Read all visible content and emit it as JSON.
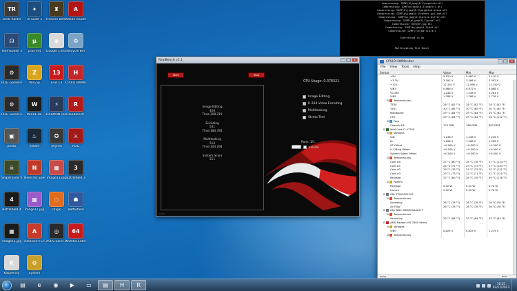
{
  "desktop_icons": [
    {
      "label": "Tomb Raider",
      "color": "#3b3b3b",
      "glyph": "TR"
    },
    {
      "label": "AI Suite 3",
      "color": "#1c4e7f",
      "glyph": "✦"
    },
    {
      "label": "Heaven Benchma...",
      "color": "#4a3a1e",
      "glyph": "♜"
    },
    {
      "label": "Adobe Reader X",
      "color": "#b31414",
      "glyph": "A"
    },
    {
      "label": "TeamSpeak 3 Client",
      "color": "#2a4a7a",
      "glyph": "☊"
    },
    {
      "label": "µTorrent",
      "color": "#3a8a2a",
      "glyph": "µ"
    },
    {
      "label": "Google Chrome",
      "color": "#d8d8d8",
      "glyph": "◉"
    },
    {
      "label": "Recycle Bin",
      "color": "#7aa3c8",
      "glyph": "♻"
    },
    {
      "label": "ROG GameFirst II",
      "color": "#2a2a2a",
      "glyph": "⚙"
    },
    {
      "label": "WinZip",
      "color": "#d8a41c",
      "glyph": "Z"
    },
    {
      "label": "FIFA 13",
      "color": "#c81c1c",
      "glyph": "13"
    },
    {
      "label": "CPUID HWMonitor",
      "color": "#c0282b",
      "glyph": "H"
    },
    {
      "label": "ROG GameFirst...",
      "color": "#2a2a2a",
      "glyph": "⚙"
    },
    {
      "label": "WinRE.RE",
      "color": "#1c1c1c",
      "glyph": "W"
    },
    {
      "label": "DAEMON Tools Lite",
      "color": "#2a3a5a",
      "glyph": "⚡"
    },
    {
      "label": "RealBench",
      "color": "#b31b1b",
      "glyph": "R"
    },
    {
      "label": "photo",
      "color": "#555",
      "glyph": "▣"
    },
    {
      "label": "Steam",
      "color": "#1b2838",
      "glyph": "♨"
    },
    {
      "label": "Skyrim",
      "color": "#3a3a3a",
      "glyph": "✪"
    },
    {
      "label": "ROG",
      "color": "#a31a1a",
      "glyph": "⚔"
    },
    {
      "label": "Sniper Elite V2",
      "color": "#3a4a2a",
      "glyph": "☠"
    },
    {
      "label": "Need for Speed",
      "color": "#c0392b",
      "glyph": "N"
    },
    {
      "label": "image13.jpg",
      "color": "#c84a4a",
      "glyph": "▦"
    },
    {
      "label": "Battlefield 3",
      "color": "#2a2a2a",
      "glyph": "3"
    },
    {
      "label": "Battlefield 4",
      "color": "#1a1a1a",
      "glyph": "4"
    },
    {
      "label": "image12.jpg",
      "color": "#9a5ac8",
      "glyph": "▦"
    },
    {
      "label": "Origin",
      "color": "#e06c1c",
      "glyph": "◌"
    },
    {
      "label": "Battlefield",
      "color": "#2f5aa0",
      "glyph": "☗"
    },
    {
      "label": "image11.jpg",
      "color": "#1a1a1a",
      "glyph": "▦"
    },
    {
      "label": "Assassin's Creed",
      "color": "#c83a2a",
      "glyph": "A"
    },
    {
      "label": "ASUS Sonic Radar",
      "color": "#2a2a2a",
      "glyph": "◎"
    },
    {
      "label": "AIDA64 Extreme",
      "color": "#c81c1c",
      "glyph": "64"
    },
    {
      "label": "Kaspersky",
      "color": "#d8d8d8",
      "glyph": "K"
    },
    {
      "label": "System",
      "color": "#c8a02a",
      "glyph": "⚙"
    }
  ],
  "console": {
    "lines": [
      "Compressing: G2MF\\b\\jpeg\\0.2\\pngstate.dll",
      "Compressing: G2MF\\b\\jpeg\\0.3\\pngctrl.dll",
      "Compressing: G2MF\\b\\jpeg\\0.3\\weighted.blend.dll",
      "Compressing: G2MF\\b\\jpeg\\0.3\\render.ppl_cad.dll",
      "Compressing: G2MF\\b\\jpeg\\0.3\\write.buffer.dll",
      "Compressing: G2MF\\b\\jpeg\\0.2\\pixel.dll",
      "Compressing: Render\\jpg.dll",
      "Compressing: G2MF\\b\\jpeg\\0.2\\mft.dll",
      "Compressing: G2MF\\c\\e\\bd\\lib.dll",
      "",
      "Everything is Ok",
      "",
      "",
      "Multitasking Test Done!"
    ]
  },
  "realbench": {
    "title": "RealBench v1.1",
    "buttons": {
      "start": "Start",
      "stop": "Stop"
    },
    "results": [
      {
        "name": "Image Editing",
        "score": "400",
        "time": "Time:208.219"
      },
      {
        "name": "Encoding",
        "score": "541",
        "time": "Time:184.783"
      },
      {
        "name": "Multitasking",
        "score": "514",
        "time": "Time:104.294"
      }
    ],
    "system_score_label": "System Score",
    "system_score": "511",
    "cpu_usage": "CPU Usage: 0.378321",
    "options": [
      {
        "label": "Image Editing",
        "checked": true
      },
      {
        "label": "H.264 Video Encoding",
        "checked": true
      },
      {
        "label": "Multitasking",
        "checked": true
      },
      {
        "label": "Stress Test",
        "checked": false
      }
    ],
    "runs_label": "Runs: 1/1",
    "infinite_label": "Infinite",
    "footer": "ASUS"
  },
  "hwmonitor": {
    "title": "CPUID HWMonitor",
    "menu": [
      "File",
      "View",
      "Tools",
      "Help"
    ],
    "columns": [
      "Sensor",
      "Value",
      "Min",
      "Max"
    ],
    "rows": [
      {
        "indent": 3,
        "name": "+5V",
        "value": "5.120 V",
        "min": "5.080 V",
        "max": "5.120 V"
      },
      {
        "indent": 3,
        "name": "+3.3V",
        "value": "3.392 V",
        "min": "3.368 V",
        "max": "3.392 V"
      },
      {
        "indent": 3,
        "name": "+12V",
        "value": "12.192 V",
        "min": "12.096 V",
        "max": "12.192 V"
      },
      {
        "indent": 3,
        "name": "VIN3",
        "value": "0.888 V",
        "min": "0.872 V",
        "max": "0.888 V"
      },
      {
        "indent": 3,
        "name": "VCORE",
        "value": "1.248 V",
        "min": "1.248 V",
        "max": "1.264 V"
      },
      {
        "indent": 3,
        "name": "VIN5",
        "value": "1.768 V",
        "min": "1.768 V",
        "max": "1.776 V"
      },
      {
        "indent": 2,
        "name": "Temperatures",
        "value": "",
        "min": "",
        "max": "",
        "group": "temp"
      },
      {
        "indent": 3,
        "name": "TZ00",
        "value": "28 °C (82 °F)",
        "min": "28 °C (82 °F)",
        "max": "28 °C (82 °F)"
      },
      {
        "indent": 3,
        "name": "TZ01",
        "value": "30 °C (85 °F)",
        "min": "30 °C (85 °F)",
        "max": "30 °C (85 °F)"
      },
      {
        "indent": 3,
        "name": "Mainboard",
        "value": "29 °C (84 °F)",
        "min": "29 °C (84 °F)",
        "max": "29 °C (84 °F)"
      },
      {
        "indent": 3,
        "name": "CPU",
        "value": "29 °C (84 °F)",
        "min": "29 °C (84 °F)",
        "max": "56 °C (132 °F)"
      },
      {
        "indent": 2,
        "name": "Fans",
        "value": "",
        "min": "",
        "max": "",
        "group": "fan"
      },
      {
        "indent": 3,
        "name": "Chassis #3",
        "value": "775 RPM",
        "min": "766 RPM",
        "max": "887 RPM"
      },
      {
        "indent": 1,
        "name": "Intel Core i7 4770K",
        "value": "",
        "min": "",
        "max": "",
        "group": "chip"
      },
      {
        "indent": 2,
        "name": "Voltages",
        "value": "",
        "min": "",
        "max": "",
        "group": "volt"
      },
      {
        "indent": 3,
        "name": "VID",
        "value": "1.238 V",
        "min": "1.238 V",
        "max": "1.238 V"
      },
      {
        "indent": 3,
        "name": "IA",
        "value": "1.268 V",
        "min": "1.268 V",
        "max": "1.268 V"
      },
      {
        "indent": 3,
        "name": "GT Offset",
        "value": "+0.000 V",
        "min": "+0.000 V",
        "max": "+0.000 V"
      },
      {
        "indent": 3,
        "name": "LLC/Ring Offset",
        "value": "+0.000 V",
        "min": "+0.000 V",
        "max": "+0.000 V"
      },
      {
        "indent": 3,
        "name": "System Agent Offset",
        "value": "+0.000 V",
        "min": "+0.000 V",
        "max": "+0.000 V"
      },
      {
        "indent": 2,
        "name": "Temperatures",
        "value": "",
        "min": "",
        "max": "",
        "group": "temp"
      },
      {
        "indent": 3,
        "name": "Core #0",
        "value": "27 °C (80 °F)",
        "min": "26 °C (78 °F)",
        "max": "57 °C (134 °F)"
      },
      {
        "indent": 3,
        "name": "Core #1",
        "value": "24 °C (75 °F)",
        "min": "23 °C (73 °F)",
        "max": "57 °C (134 °F)"
      },
      {
        "indent": 3,
        "name": "Core #2",
        "value": "26 °C (78 °F)",
        "min": "24 °C (75 °F)",
        "max": "55 °C (131 °F)"
      },
      {
        "indent": 3,
        "name": "Core #3",
        "value": "23 °C (73 °F)",
        "min": "22 °C (71 °F)",
        "max": "52 °C (125 °F)"
      },
      {
        "indent": 3,
        "name": "Package",
        "value": "27 °C (80 °F)",
        "min": "26 °C (78 °F)",
        "max": "59 °C (138 °F)"
      },
      {
        "indent": 2,
        "name": "Powers",
        "value": "",
        "min": "",
        "max": "",
        "group": "power"
      },
      {
        "indent": 3,
        "name": "Package",
        "value": "0.52 W",
        "min": "0.52 W",
        "max": "0.76 W"
      },
      {
        "indent": 3,
        "name": "Uncore",
        "value": "2.52 W",
        "min": "2.52 W",
        "max": "2.76 W"
      },
      {
        "indent": 1,
        "name": "ATA ST3500312CS",
        "value": "",
        "min": "",
        "max": "",
        "group": "disk"
      },
      {
        "indent": 2,
        "name": "Temperatures",
        "value": "",
        "min": "",
        "max": "",
        "group": "temp"
      },
      {
        "indent": 3,
        "name": "Assembly",
        "value": "26 °C (78 °F)",
        "min": "26 °C (78 °F)",
        "max": "26 °C (78 °F)"
      },
      {
        "indent": 3,
        "name": "Air Flow",
        "value": "26 °C (78 °F)",
        "min": "26 °C (78 °F)",
        "max": "26 °C (78 °F)"
      },
      {
        "indent": 1,
        "name": "ATA WDC WD5000AAKX-7",
        "value": "",
        "min": "",
        "max": "",
        "group": "disk"
      },
      {
        "indent": 2,
        "name": "Temperatures",
        "value": "",
        "min": "",
        "max": "",
        "group": "temp"
      },
      {
        "indent": 3,
        "name": "Assembly",
        "value": "29 °C (84 °F)",
        "min": "29 °C (84 °F)",
        "max": "29 °C (84 °F)"
      },
      {
        "indent": 1,
        "name": "AMD Radeon HD 7800 Series",
        "value": "",
        "min": "",
        "max": "",
        "group": "gpu"
      },
      {
        "indent": 2,
        "name": "Voltages",
        "value": "",
        "min": "",
        "max": "",
        "group": "volt"
      },
      {
        "indent": 3,
        "name": "VIN0",
        "value": "0.825 V",
        "min": "0.825 V",
        "max": "1.219 V"
      },
      {
        "indent": 2,
        "name": "Temperatures",
        "value": "",
        "min": "",
        "max": "",
        "group": "temp"
      }
    ],
    "status": "Ready",
    "status_right": "NUM"
  },
  "taskbar": {
    "buttons": [
      {
        "label": "Windows Explorer",
        "glyph": "▤",
        "active": false
      },
      {
        "label": "Internet Explorer",
        "glyph": "e",
        "active": false
      },
      {
        "label": "Google Chrome",
        "glyph": "◉",
        "active": false
      },
      {
        "label": "Windows Media Player",
        "glyph": "▶",
        "active": false
      },
      {
        "label": "Folder",
        "glyph": "▭",
        "active": false
      },
      {
        "label": "Explorer",
        "glyph": "▤",
        "active": true
      },
      {
        "label": "CPUID HWMonitor",
        "glyph": "H",
        "active": true
      },
      {
        "label": "RealBench",
        "glyph": "R",
        "active": true
      }
    ],
    "time": "16:35",
    "date": "03/11/2013"
  },
  "colors": {
    "rog_red": "#b31b1b",
    "desktop_blue": "#1a6fb5"
  }
}
